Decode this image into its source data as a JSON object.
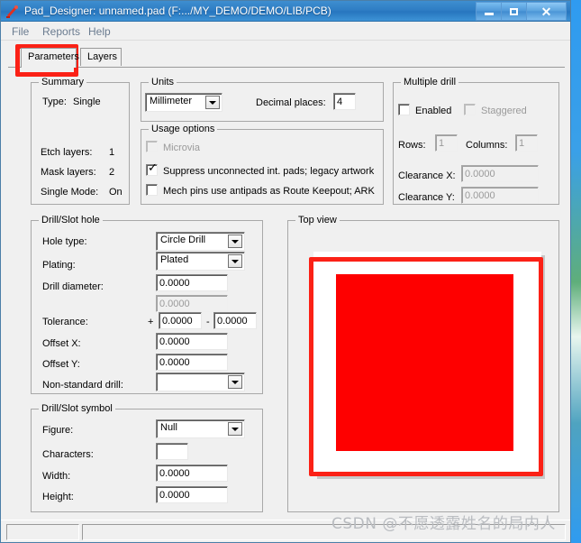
{
  "window": {
    "title": "Pad_Designer: unnamed.pad (F:.../MY_DEMO/DEMO/LIB/PCB)",
    "icon": "pad-designer-icon",
    "minimize_label": "–",
    "maximize_label": "□",
    "close_label": "✕"
  },
  "menu": {
    "items": [
      {
        "label": "File"
      },
      {
        "label": "Reports"
      },
      {
        "label": "Help"
      }
    ]
  },
  "tabs": [
    {
      "label": "Parameters",
      "selected": true
    },
    {
      "label": "Layers",
      "selected": false
    }
  ],
  "summary": {
    "legend": "Summary",
    "rows": [
      {
        "label": "Type:",
        "value": "Single"
      },
      {
        "label": "Etch layers:",
        "value": "1"
      },
      {
        "label": "Mask layers:",
        "value": "2"
      },
      {
        "label": "Single Mode:",
        "value": "On"
      }
    ]
  },
  "units": {
    "legend": "Units",
    "unit_value": "Millimeter",
    "decimal_places_label": "Decimal places:",
    "decimal_places_value": "4"
  },
  "usage_options": {
    "legend": "Usage options",
    "items": [
      {
        "label": "Microvia",
        "checked": false,
        "disabled": true
      },
      {
        "label": "Suppress unconnected int. pads; legacy artwork",
        "checked": true,
        "disabled": false
      },
      {
        "label": "Mech pins use antipads as Route Keepout; ARK",
        "checked": false,
        "disabled": false
      }
    ]
  },
  "multiple_drill": {
    "legend": "Multiple drill",
    "enabled_label": "Enabled",
    "enabled_checked": false,
    "staggered_label": "Staggered",
    "staggered_checked": false,
    "staggered_disabled": true,
    "rows_label": "Rows:",
    "rows_value": "1",
    "columns_label": "Columns:",
    "columns_value": "1",
    "clearance_x_label": "Clearance X:",
    "clearance_x_value": "0.0000",
    "clearance_y_label": "Clearance Y:",
    "clearance_y_value": "0.0000"
  },
  "drill_slot_hole": {
    "legend": "Drill/Slot hole",
    "hole_type_label": "Hole type:",
    "hole_type_value": "Circle Drill",
    "plating_label": "Plating:",
    "plating_value": "Plated",
    "drill_diameter_label": "Drill diameter:",
    "drill_diameter_value": "0.0000",
    "drill_diameter_value2": "0.0000",
    "tolerance_label": "Tolerance:",
    "tolerance_plus_sign": "+",
    "tolerance_plus_value": "0.0000",
    "tolerance_minus_sign": "-",
    "tolerance_minus_value": "0.0000",
    "offset_x_label": "Offset X:",
    "offset_x_value": "0.0000",
    "offset_y_label": "Offset Y:",
    "offset_y_value": "0.0000",
    "non_standard_drill_label": "Non-standard drill:",
    "non_standard_drill_value": ""
  },
  "drill_slot_symbol": {
    "legend": "Drill/Slot symbol",
    "figure_label": "Figure:",
    "figure_value": "Null",
    "characters_label": "Characters:",
    "characters_value": "",
    "width_label": "Width:",
    "width_value": "0.0000",
    "height_label": "Height:",
    "height_value": "0.0000"
  },
  "top_view": {
    "legend": "Top view",
    "pad_color": "#fe0000",
    "canvas_color": "#ffffff",
    "annotation_color": "#fb2116"
  },
  "annotations": {
    "tab_highlight_color": "#fb2116"
  },
  "watermark": {
    "text": "CSDN @不愿透露姓名的局内人"
  },
  "statusbar": {
    "pane1": "",
    "pane2": ""
  }
}
